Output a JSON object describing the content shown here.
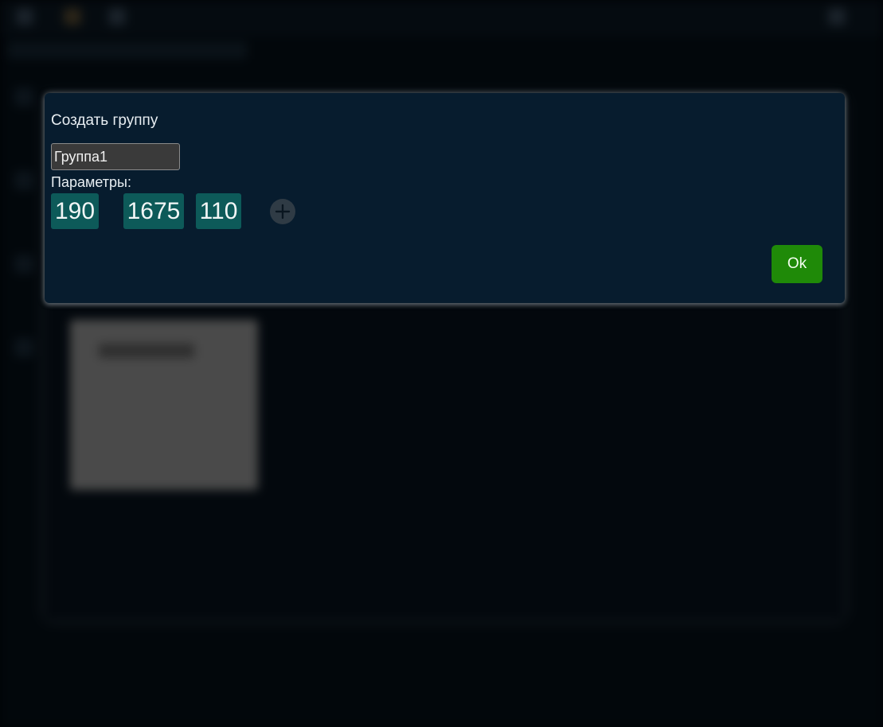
{
  "dialog": {
    "title": "Создать группу",
    "name_value": "Группа1",
    "params_label": "Параметры:",
    "params": [
      "190",
      "1675",
      "110"
    ],
    "add_icon": "plus-icon",
    "ok_label": "Ok"
  },
  "colors": {
    "dialog_bg": "#071c2e",
    "chip_bg": "#0d5a59",
    "ok_bg": "#1f8a08",
    "page_bg": "#010306"
  }
}
